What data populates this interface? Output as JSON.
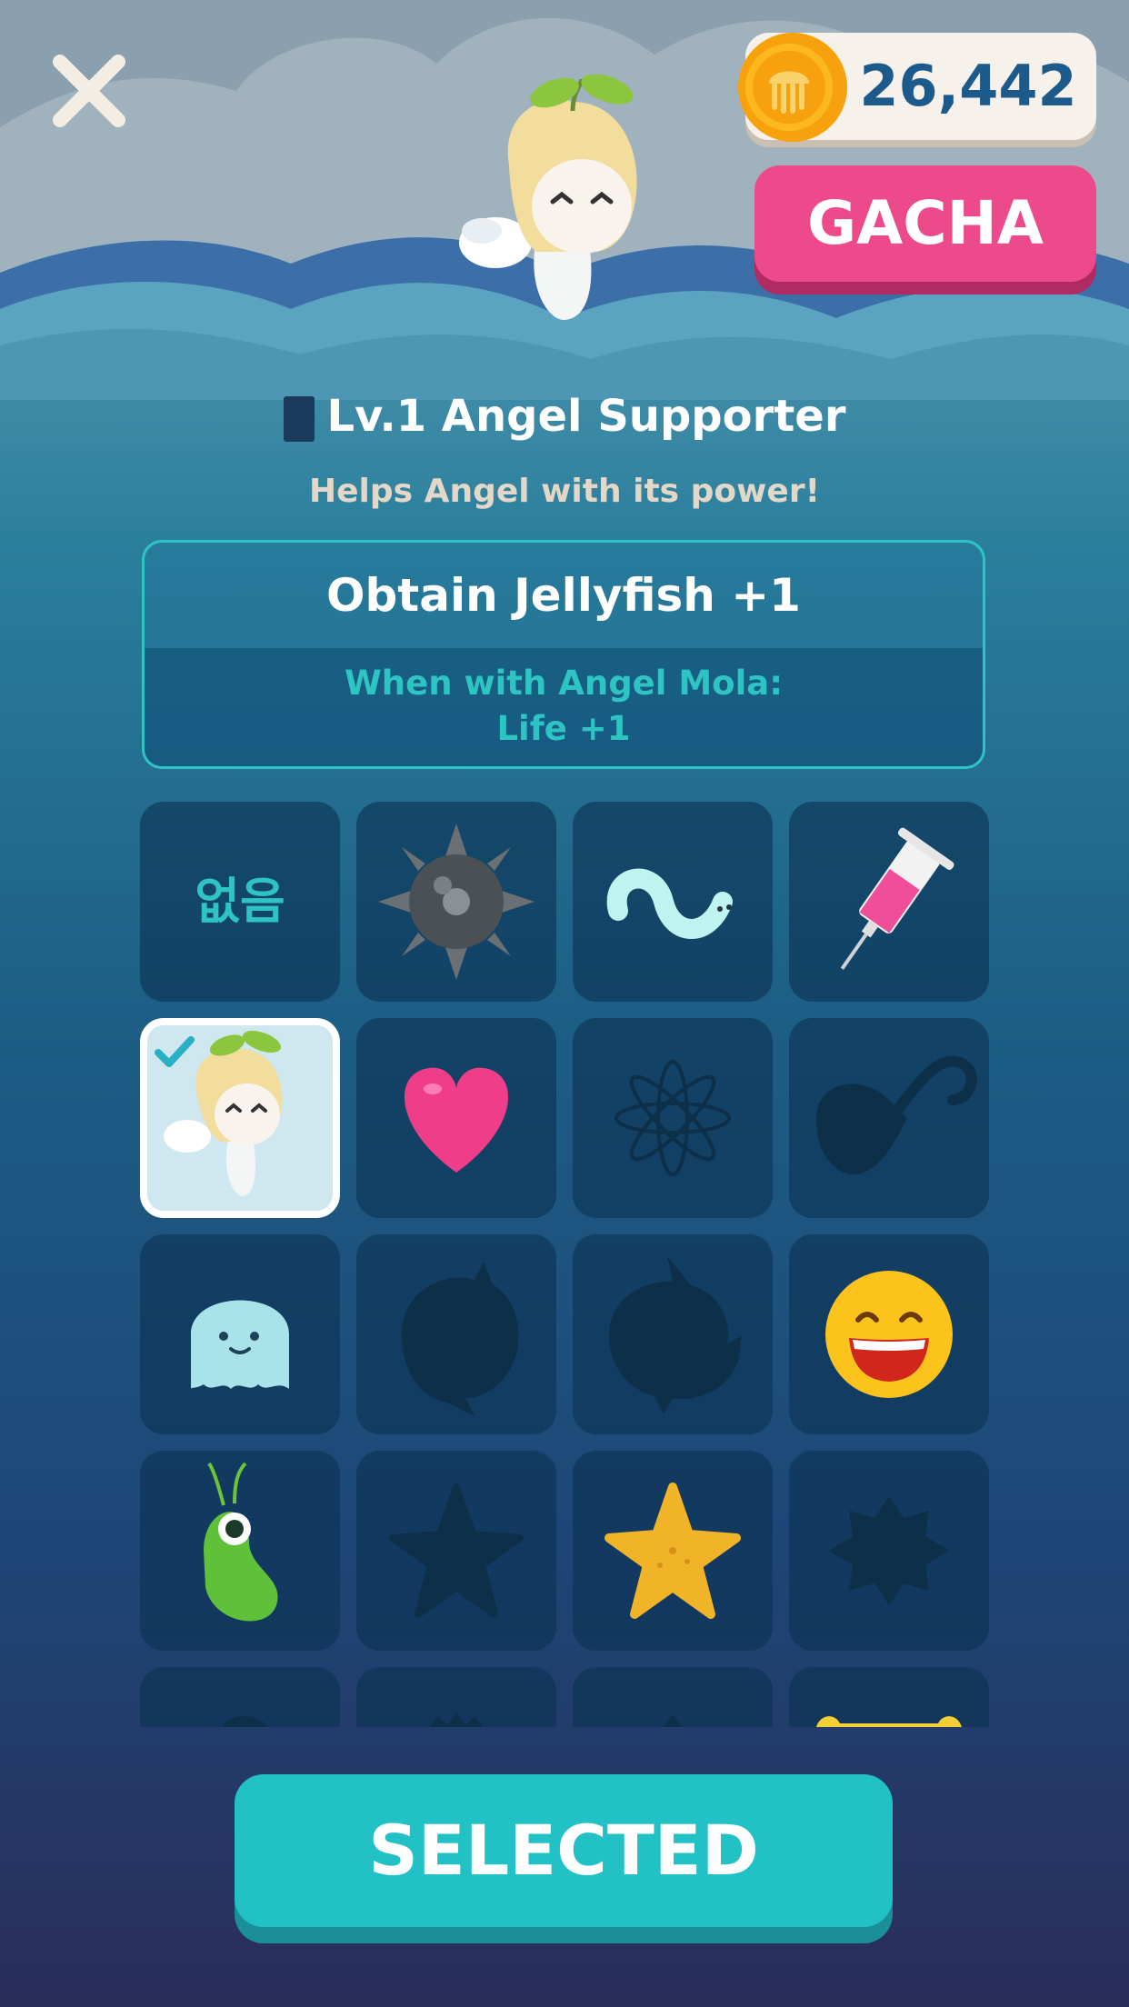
{
  "header": {
    "close_icon": "close-icon",
    "currency": {
      "icon": "jellyfish-coin-icon",
      "value": "26,442"
    },
    "gacha_label": "GACHA"
  },
  "item": {
    "title": "Lv.1 Angel Supporter",
    "description": "Helps Angel with its power!",
    "effect": "Obtain Jellyfish +1",
    "bonus_line1": "When with Angel Mola:",
    "bonus_line2": "Life +1"
  },
  "grid": {
    "none_label": "없음",
    "items": [
      {
        "icon": "none-label",
        "state": "unlocked"
      },
      {
        "icon": "spiked-mine-icon",
        "state": "unlocked"
      },
      {
        "icon": "glowing-worm-icon",
        "state": "unlocked"
      },
      {
        "icon": "syringe-icon",
        "state": "unlocked"
      },
      {
        "icon": "angel-supporter-icon",
        "state": "selected"
      },
      {
        "icon": "heart-icon",
        "state": "unlocked"
      },
      {
        "icon": "lotus-silhouette-icon",
        "state": "locked"
      },
      {
        "icon": "hook-silhouette-icon",
        "state": "locked"
      },
      {
        "icon": "ghost-icon",
        "state": "unlocked"
      },
      {
        "icon": "mola-silhouette-icon",
        "state": "locked"
      },
      {
        "icon": "mola-silhouette-icon",
        "state": "locked"
      },
      {
        "icon": "laughing-emoji-icon",
        "state": "unlocked"
      },
      {
        "icon": "green-bean-icon",
        "state": "unlocked"
      },
      {
        "icon": "starfish-silhouette-icon",
        "state": "locked"
      },
      {
        "icon": "starfish-icon",
        "state": "unlocked"
      },
      {
        "icon": "sun-silhouette-icon",
        "state": "locked"
      }
    ]
  },
  "footer": {
    "selected_label": "SELECTED"
  },
  "colors": {
    "accent_teal": "#22c1c6",
    "gacha_pink": "#ed4a8c",
    "coin_orange": "#f7a20c",
    "currency_text": "#1d5a8c"
  }
}
